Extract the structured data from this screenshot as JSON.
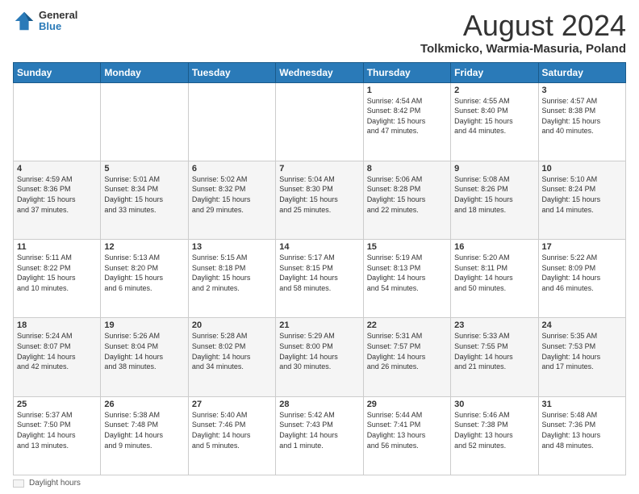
{
  "header": {
    "logo": {
      "line1": "General",
      "line2": "Blue"
    },
    "title": "August 2024",
    "subtitle": "Tolkmicko, Warmia-Masuria, Poland"
  },
  "weekdays": [
    "Sunday",
    "Monday",
    "Tuesday",
    "Wednesday",
    "Thursday",
    "Friday",
    "Saturday"
  ],
  "weeks": [
    [
      {
        "day": "",
        "info": ""
      },
      {
        "day": "",
        "info": ""
      },
      {
        "day": "",
        "info": ""
      },
      {
        "day": "",
        "info": ""
      },
      {
        "day": "1",
        "info": "Sunrise: 4:54 AM\nSunset: 8:42 PM\nDaylight: 15 hours\nand 47 minutes."
      },
      {
        "day": "2",
        "info": "Sunrise: 4:55 AM\nSunset: 8:40 PM\nDaylight: 15 hours\nand 44 minutes."
      },
      {
        "day": "3",
        "info": "Sunrise: 4:57 AM\nSunset: 8:38 PM\nDaylight: 15 hours\nand 40 minutes."
      }
    ],
    [
      {
        "day": "4",
        "info": "Sunrise: 4:59 AM\nSunset: 8:36 PM\nDaylight: 15 hours\nand 37 minutes."
      },
      {
        "day": "5",
        "info": "Sunrise: 5:01 AM\nSunset: 8:34 PM\nDaylight: 15 hours\nand 33 minutes."
      },
      {
        "day": "6",
        "info": "Sunrise: 5:02 AM\nSunset: 8:32 PM\nDaylight: 15 hours\nand 29 minutes."
      },
      {
        "day": "7",
        "info": "Sunrise: 5:04 AM\nSunset: 8:30 PM\nDaylight: 15 hours\nand 25 minutes."
      },
      {
        "day": "8",
        "info": "Sunrise: 5:06 AM\nSunset: 8:28 PM\nDaylight: 15 hours\nand 22 minutes."
      },
      {
        "day": "9",
        "info": "Sunrise: 5:08 AM\nSunset: 8:26 PM\nDaylight: 15 hours\nand 18 minutes."
      },
      {
        "day": "10",
        "info": "Sunrise: 5:10 AM\nSunset: 8:24 PM\nDaylight: 15 hours\nand 14 minutes."
      }
    ],
    [
      {
        "day": "11",
        "info": "Sunrise: 5:11 AM\nSunset: 8:22 PM\nDaylight: 15 hours\nand 10 minutes."
      },
      {
        "day": "12",
        "info": "Sunrise: 5:13 AM\nSunset: 8:20 PM\nDaylight: 15 hours\nand 6 minutes."
      },
      {
        "day": "13",
        "info": "Sunrise: 5:15 AM\nSunset: 8:18 PM\nDaylight: 15 hours\nand 2 minutes."
      },
      {
        "day": "14",
        "info": "Sunrise: 5:17 AM\nSunset: 8:15 PM\nDaylight: 14 hours\nand 58 minutes."
      },
      {
        "day": "15",
        "info": "Sunrise: 5:19 AM\nSunset: 8:13 PM\nDaylight: 14 hours\nand 54 minutes."
      },
      {
        "day": "16",
        "info": "Sunrise: 5:20 AM\nSunset: 8:11 PM\nDaylight: 14 hours\nand 50 minutes."
      },
      {
        "day": "17",
        "info": "Sunrise: 5:22 AM\nSunset: 8:09 PM\nDaylight: 14 hours\nand 46 minutes."
      }
    ],
    [
      {
        "day": "18",
        "info": "Sunrise: 5:24 AM\nSunset: 8:07 PM\nDaylight: 14 hours\nand 42 minutes."
      },
      {
        "day": "19",
        "info": "Sunrise: 5:26 AM\nSunset: 8:04 PM\nDaylight: 14 hours\nand 38 minutes."
      },
      {
        "day": "20",
        "info": "Sunrise: 5:28 AM\nSunset: 8:02 PM\nDaylight: 14 hours\nand 34 minutes."
      },
      {
        "day": "21",
        "info": "Sunrise: 5:29 AM\nSunset: 8:00 PM\nDaylight: 14 hours\nand 30 minutes."
      },
      {
        "day": "22",
        "info": "Sunrise: 5:31 AM\nSunset: 7:57 PM\nDaylight: 14 hours\nand 26 minutes."
      },
      {
        "day": "23",
        "info": "Sunrise: 5:33 AM\nSunset: 7:55 PM\nDaylight: 14 hours\nand 21 minutes."
      },
      {
        "day": "24",
        "info": "Sunrise: 5:35 AM\nSunset: 7:53 PM\nDaylight: 14 hours\nand 17 minutes."
      }
    ],
    [
      {
        "day": "25",
        "info": "Sunrise: 5:37 AM\nSunset: 7:50 PM\nDaylight: 14 hours\nand 13 minutes."
      },
      {
        "day": "26",
        "info": "Sunrise: 5:38 AM\nSunset: 7:48 PM\nDaylight: 14 hours\nand 9 minutes."
      },
      {
        "day": "27",
        "info": "Sunrise: 5:40 AM\nSunset: 7:46 PM\nDaylight: 14 hours\nand 5 minutes."
      },
      {
        "day": "28",
        "info": "Sunrise: 5:42 AM\nSunset: 7:43 PM\nDaylight: 14 hours\nand 1 minute."
      },
      {
        "day": "29",
        "info": "Sunrise: 5:44 AM\nSunset: 7:41 PM\nDaylight: 13 hours\nand 56 minutes."
      },
      {
        "day": "30",
        "info": "Sunrise: 5:46 AM\nSunset: 7:38 PM\nDaylight: 13 hours\nand 52 minutes."
      },
      {
        "day": "31",
        "info": "Sunrise: 5:48 AM\nSunset: 7:36 PM\nDaylight: 13 hours\nand 48 minutes."
      }
    ]
  ],
  "footer": {
    "legend_label": "Daylight hours"
  }
}
